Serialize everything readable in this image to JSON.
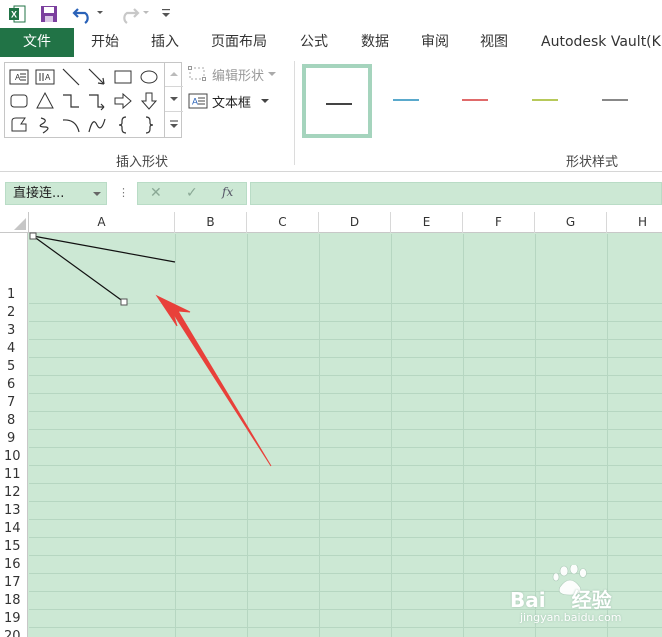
{
  "ribbon_tabs": {
    "file": "文件",
    "home": "开始",
    "insert": "插入",
    "page_layout": "页面布局",
    "formulas": "公式",
    "data": "数据",
    "review": "审阅",
    "view": "视图",
    "vault": "Autodesk Vault(K"
  },
  "ribbon": {
    "edit_shape": "编辑形状",
    "text_box": "文本框",
    "insert_shapes_group": "插入形状",
    "shape_styles_group": "形状样式",
    "style_line_colors": [
      "#444444",
      "#5aa9cc",
      "#e06a6a",
      "#b7c95a",
      "#888888"
    ]
  },
  "formula_bar": {
    "name_box": "直接连...",
    "cancel": "✕",
    "enter": "✓",
    "fx": "fx"
  },
  "columns": [
    "A",
    "B",
    "C",
    "D",
    "E",
    "F",
    "G",
    "H"
  ],
  "rows": [
    "1",
    "2",
    "3",
    "4",
    "5",
    "6",
    "7",
    "8",
    "9",
    "10",
    "11",
    "12",
    "13",
    "14",
    "15",
    "16",
    "17",
    "18",
    "19",
    "20"
  ],
  "colors": {
    "file_tab": "#217346",
    "cell_fill": "#cce8d4",
    "arrow": "#e8403a"
  },
  "watermark": {
    "brand": "Bai",
    "brand_suffix": "经验",
    "url": "jingyan.baidu.com"
  }
}
